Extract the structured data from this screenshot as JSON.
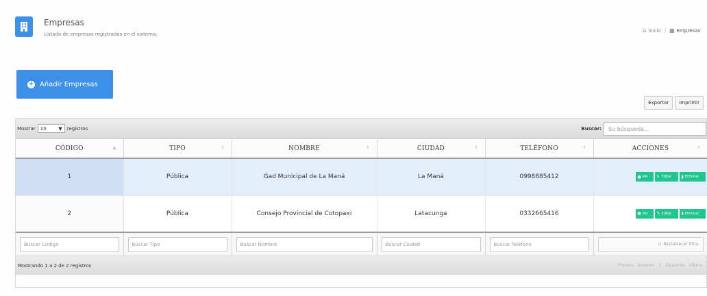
{
  "header": {
    "title": "Empresas",
    "subtitle": "Listado de empresas registradas en el sistema.",
    "icon": "building-icon",
    "accent": "#3d8fe8"
  },
  "breadcrumb": {
    "home_label": "Inicio",
    "separator": "/",
    "current_label": "Empresas"
  },
  "actions": {
    "add_label": "Añadir Empresas",
    "export_label": "Exportar",
    "print_label": "Imprimir"
  },
  "table_controls": {
    "show_prefix": "Mostrar",
    "page_length": "10",
    "show_suffix": "registros",
    "search_label": "Buscar:",
    "search_placeholder": "Su búsqueda..."
  },
  "columns": [
    {
      "label": "CÓDIGO"
    },
    {
      "label": "TIPO"
    },
    {
      "label": "NOMBRE"
    },
    {
      "label": "CIUDAD"
    },
    {
      "label": "TELÉFONO"
    },
    {
      "label": "ACCIONES"
    }
  ],
  "rows": [
    {
      "codigo": "1",
      "tipo": "Pública",
      "nombre": "Gad Municipal de La Maná",
      "ciudad": "La Maná",
      "telefono": "0998885412"
    },
    {
      "codigo": "2",
      "tipo": "Pública",
      "nombre": "Consejo Provincial de Cotopaxi",
      "ciudad": "Latacunga",
      "telefono": "0332665416"
    }
  ],
  "row_actions": {
    "view_label": "Ver",
    "edit_label": "Editar",
    "delete_label": "Eliminar",
    "button_color": "#21c58e"
  },
  "filters": {
    "codigo": "Buscar Código",
    "tipo": "Buscar Tipo",
    "nombre": "Buscar Nombre",
    "ciudad": "Buscar Ciudad",
    "telefono": "Buscar Teléfono",
    "reset_label": "Restablecer filtro"
  },
  "footer": {
    "info": "Mostrando 1 a 2 de 2 registros",
    "pager": {
      "first": "Primero",
      "previous": "Anterior",
      "page": "1",
      "next": "Siguiente",
      "last": "Último"
    }
  }
}
